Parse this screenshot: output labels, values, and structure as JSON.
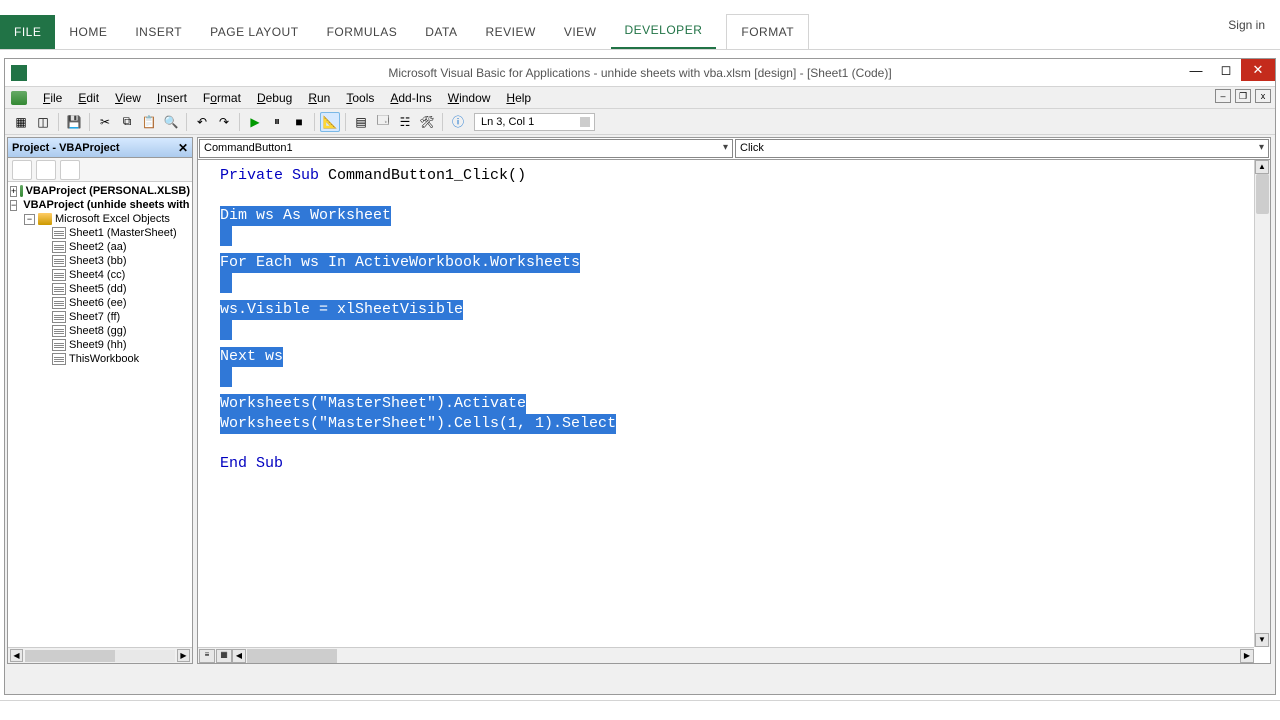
{
  "ribbon": {
    "tabs": [
      "FILE",
      "HOME",
      "INSERT",
      "PAGE LAYOUT",
      "FORMULAS",
      "DATA",
      "REVIEW",
      "VIEW",
      "DEVELOPER",
      "FORMAT"
    ],
    "signin": "Sign in"
  },
  "vba": {
    "title": "Microsoft Visual Basic for Applications - unhide sheets with vba.xlsm [design] - [Sheet1 (Code)]",
    "menus": [
      "File",
      "Edit",
      "View",
      "Insert",
      "Format",
      "Debug",
      "Run",
      "Tools",
      "Add-Ins",
      "Window",
      "Help"
    ],
    "position": "Ln 3, Col 1"
  },
  "project": {
    "title": "Project - VBAProject",
    "root1": "VBAProject (PERSONAL.XLSB)",
    "root2": "VBAProject (unhide sheets with vba.xlsm)",
    "folder": "Microsoft Excel Objects",
    "sheets": [
      "Sheet1 (MasterSheet)",
      "Sheet2 (aa)",
      "Sheet3 (bb)",
      "Sheet4 (cc)",
      "Sheet5 (dd)",
      "Sheet6 (ee)",
      "Sheet7 (ff)",
      "Sheet8 (gg)",
      "Sheet9 (hh)",
      "ThisWorkbook"
    ]
  },
  "dropdowns": {
    "object": "CommandButton1",
    "procedure": "Click"
  },
  "code": {
    "l1a": "Private Sub",
    "l1b": " CommandButton1_Click()",
    "l2": "Dim ws As Worksheet",
    "l3": "For Each ws In ActiveWorkbook.Worksheets",
    "l4": "ws.Visible = xlSheetVisible",
    "l5": "Next ws",
    "l6": "Worksheets(\"MasterSheet\").Activate",
    "l7": "Worksheets(\"MasterSheet\").Cells(1, 1).Select",
    "l8": "End Sub"
  }
}
